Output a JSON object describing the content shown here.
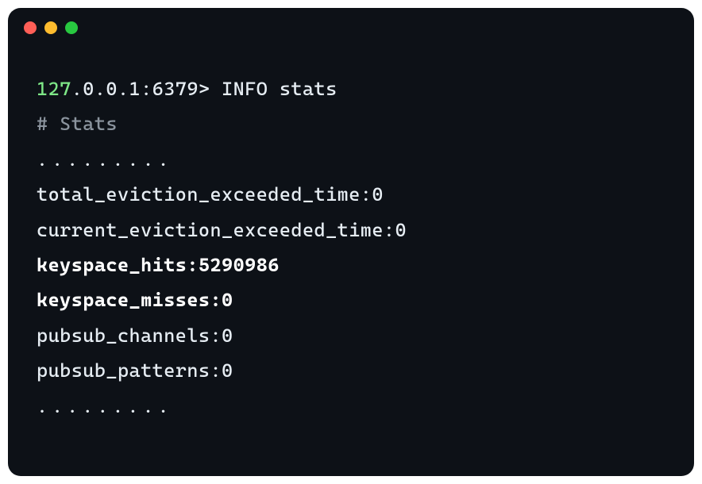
{
  "prompt": {
    "host": "127",
    "rest": ".0.0.1:6379>",
    "command": "INFO stats"
  },
  "output": {
    "header_comment": "# Stats",
    "ellipsis_1": ".........",
    "lines": [
      {
        "text": "total_eviction_exceeded_time:0",
        "bold": false
      },
      {
        "text": "current_eviction_exceeded_time:0",
        "bold": false
      },
      {
        "text": "keyspace_hits:5290986",
        "bold": true
      },
      {
        "text": "keyspace_misses:0",
        "bold": true
      },
      {
        "text": "pubsub_channels:0",
        "bold": false
      },
      {
        "text": "pubsub_patterns:0",
        "bold": false
      }
    ],
    "ellipsis_2": "........."
  }
}
